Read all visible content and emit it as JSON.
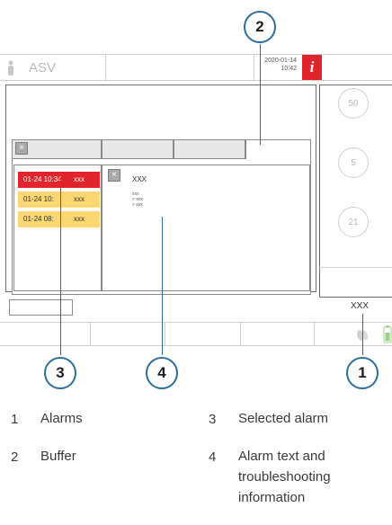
{
  "screen": {
    "mode": "ASV",
    "date": "2020-01-14",
    "time": "10:42",
    "info_icon": "i",
    "status_value": "XXX",
    "dials": [
      "50",
      "5",
      "21"
    ]
  },
  "alarm_dialog": {
    "close_icon": "×",
    "alarms": [
      {
        "datetime": "01-24 10:34",
        "text": "xxx",
        "color": "#e0242c",
        "selected": true
      },
      {
        "datetime": "01-24 10:",
        "text": "xxx",
        "color": "#fbd774",
        "selected": false
      },
      {
        "datetime": "01-24 08:",
        "text": "xxx",
        "color": "#fbd774",
        "selected": false
      }
    ],
    "detail": {
      "icon": "×",
      "title": "XXX",
      "body_lines": [
        "xxx",
        "> xxx",
        "> xxx"
      ]
    }
  },
  "callouts": [
    "2",
    "3",
    "4",
    "1"
  ],
  "legend": [
    {
      "num": "1",
      "text": "Alarms"
    },
    {
      "num": "3",
      "text": "Selected alarm"
    },
    {
      "num": "2",
      "text": "Buffer"
    },
    {
      "num": "4",
      "text_lines": [
        "Alarm text and",
        "troubleshooting",
        "information"
      ]
    }
  ],
  "colors": {
    "callout": "#2b6f9e",
    "high_priority": "#e0242c",
    "medium_priority": "#fbd774"
  }
}
